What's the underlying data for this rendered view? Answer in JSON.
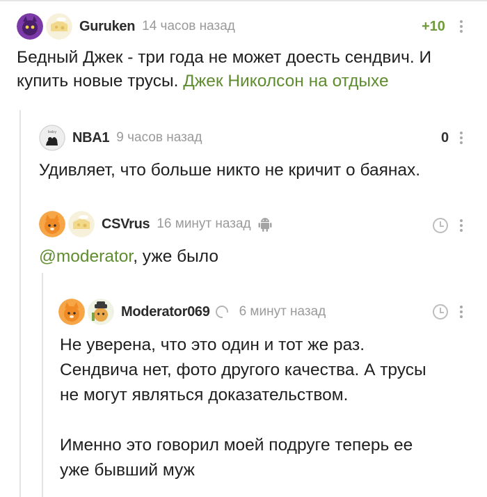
{
  "comments": [
    {
      "username": "Guruken",
      "time": "14 часов назад",
      "rating": "+10",
      "text": "Бедный Джек - три года не может доесть сендвич. И купить новые трусы.",
      "link_text": "Джек Николсон на отдыхе",
      "avatar_icon": "purple-cat-avatar",
      "badge_icon": "cheese-badge"
    },
    {
      "username": "NBA1",
      "time": "9 часов назад",
      "rating": "0",
      "text": "Удивляет, что больше никто не кричит о баянах.",
      "avatar_icon": "black-cat-sketch-avatar"
    },
    {
      "username": "CSVrus",
      "time": "16 минут назад",
      "mention": "@moderator",
      "text": ", уже было",
      "platform_icon": "android-icon",
      "avatar_icon": "orange-cat-avatar",
      "badge_icon": "cheese-badge"
    },
    {
      "username": "Moderator069",
      "time": "6 минут назад",
      "text_lines": [
        "Не уверена, что это один и тот же раз.",
        "Сендвича нет, фото другого качества. А трусы",
        "не могут являться доказательством.",
        "",
        "Именно это говорил моей подруге теперь ее",
        "уже бывший муж"
      ],
      "avatar_icon": "orange-cat-avatar",
      "badge_icon": "moderator-cat-badge"
    }
  ],
  "colors": {
    "link": "#5f8c2e",
    "rating_positive": "#6f9b3c",
    "muted": "#9a9a9a",
    "thread_line": "#e4e4e4"
  }
}
